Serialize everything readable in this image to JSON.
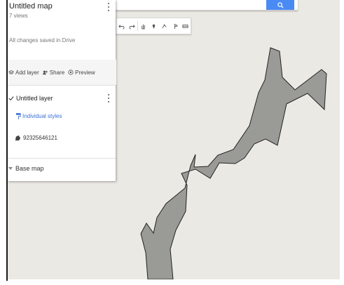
{
  "map": {
    "title": "Untitled map",
    "views": "7 views",
    "saved_status": "All changes saved in Drive"
  },
  "actions": {
    "add_layer": "Add layer",
    "share": "Share",
    "preview": "Preview"
  },
  "layer": {
    "name": "Untitled layer",
    "style_link": "Individual styles",
    "feature_label": "92325646121"
  },
  "base_map": {
    "label": "Base map"
  },
  "toolbar": {
    "tools": [
      "undo-icon",
      "redo-icon",
      "hand-icon",
      "marker-icon",
      "line-icon",
      "directions-icon",
      "ruler-icon"
    ]
  },
  "colors": {
    "map_background": "#ebe9e4",
    "polygon_fill": "#9a9a96",
    "polygon_stroke": "#222222",
    "search_button": "#4a8af4",
    "link": "#3a6fd8"
  }
}
